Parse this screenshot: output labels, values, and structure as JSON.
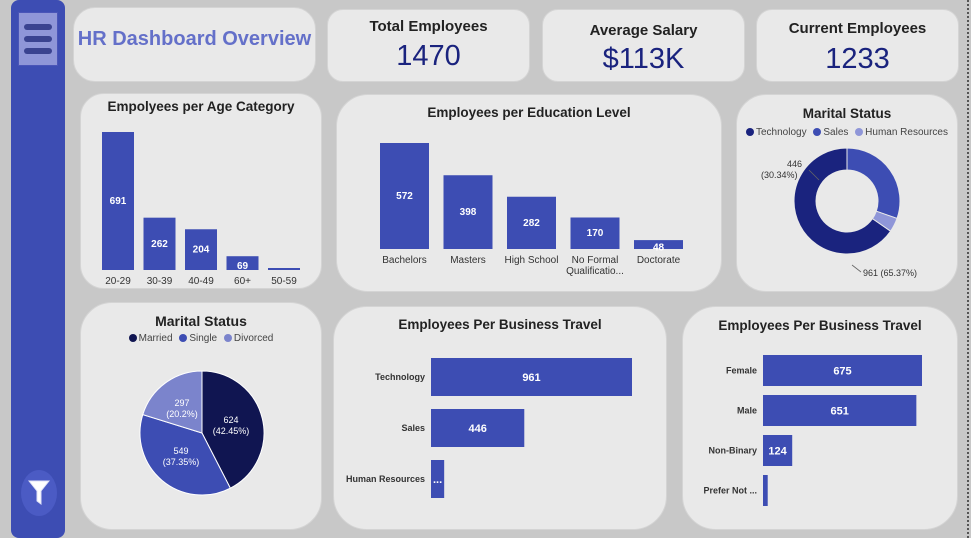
{
  "colors": {
    "bar": "#3d4db3",
    "dark": "#101551",
    "mid": "#3d4db3",
    "light": "#7b84cc"
  },
  "header": {
    "title": "HR Dashboard Overview"
  },
  "kpis": [
    {
      "title": "Total Employees",
      "value": "1470"
    },
    {
      "title": "Average Salary",
      "value": "$113K"
    },
    {
      "title": "Current Employees",
      "value": "1233"
    }
  ],
  "sidebar": {
    "menu_icon": "hamburger-icon",
    "filter_icon": "filter-icon"
  },
  "chart_data": [
    {
      "type": "bar",
      "title": "Empolyees per Age Category",
      "categories": [
        "20-29",
        "30-39",
        "40-49",
        "60+",
        "50-59"
      ],
      "values": [
        691,
        262,
        204,
        69,
        5
      ],
      "value_labels": [
        "691",
        "262",
        "204",
        "69",
        ""
      ]
    },
    {
      "type": "bar",
      "title": "Employees per Education Level",
      "categories": [
        "Bachelors",
        "Masters",
        "High School",
        "No Formal Qualificatio...",
        "Doctorate"
      ],
      "values": [
        572,
        398,
        282,
        170,
        48
      ],
      "value_labels": [
        "572",
        "398",
        "282",
        "170",
        "48"
      ]
    },
    {
      "type": "pie",
      "subtype": "donut",
      "title": "Marital Status",
      "legend": [
        "Technology",
        "Sales",
        "Human Resources"
      ],
      "values": [
        961,
        446,
        63
      ],
      "colors": [
        "#1a237e",
        "#3d4db3",
        "#8f96d8"
      ],
      "slice_labels": [
        "961 (65.37%)",
        "446 (30.34%)",
        ""
      ]
    },
    {
      "type": "pie",
      "title": "Marital Status",
      "legend": [
        "Married",
        "Single",
        "Divorced"
      ],
      "values": [
        624,
        549,
        297
      ],
      "colors": [
        "#101551",
        "#3d4db3",
        "#7b84cc"
      ],
      "slice_labels": [
        [
          "624",
          "(42.45%)"
        ],
        [
          "549",
          "(37.35%)"
        ],
        [
          "297",
          "(20.2%)"
        ]
      ]
    },
    {
      "type": "bar",
      "orientation": "horizontal",
      "title": "Employees Per Business Travel",
      "categories": [
        "Technology",
        "Sales",
        "Human Resources"
      ],
      "values": [
        961,
        446,
        63
      ],
      "value_labels": [
        "961",
        "446",
        "..."
      ]
    },
    {
      "type": "bar",
      "orientation": "horizontal",
      "title": "Employees Per Business Travel",
      "categories": [
        "Female",
        "Male",
        "Non-Binary",
        "Prefer Not ..."
      ],
      "values": [
        675,
        651,
        124,
        20
      ],
      "value_labels": [
        "675",
        "651",
        "124",
        ""
      ]
    }
  ]
}
